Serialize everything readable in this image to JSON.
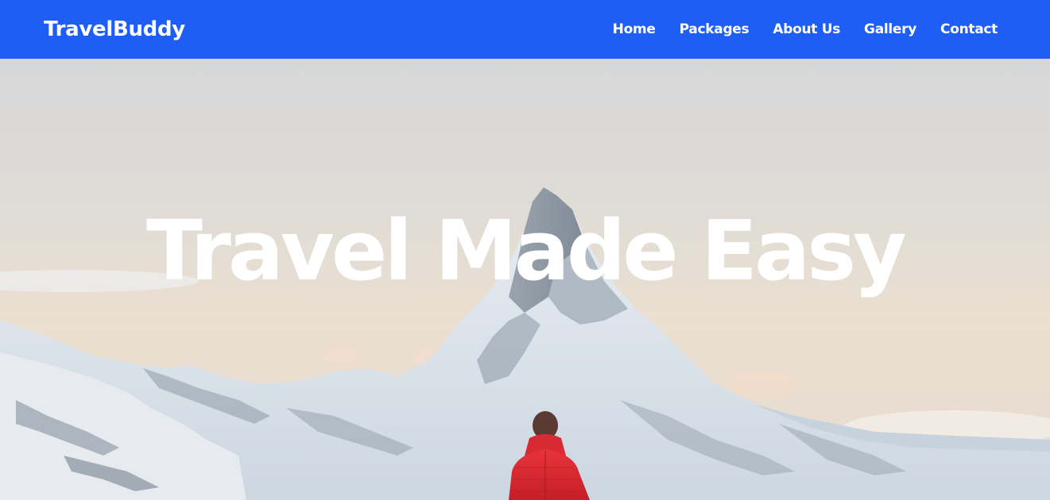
{
  "navbar": {
    "brand": "TravelBuddy",
    "links": [
      {
        "label": "Home"
      },
      {
        "label": "Packages"
      },
      {
        "label": "About Us"
      },
      {
        "label": "Gallery"
      },
      {
        "label": "Contact"
      }
    ]
  },
  "hero": {
    "title": "Travel Made Easy"
  },
  "colors": {
    "navbar_bg": "#1f5ef5",
    "nav_text": "#ffffff",
    "hero_title": "#ffffff"
  }
}
